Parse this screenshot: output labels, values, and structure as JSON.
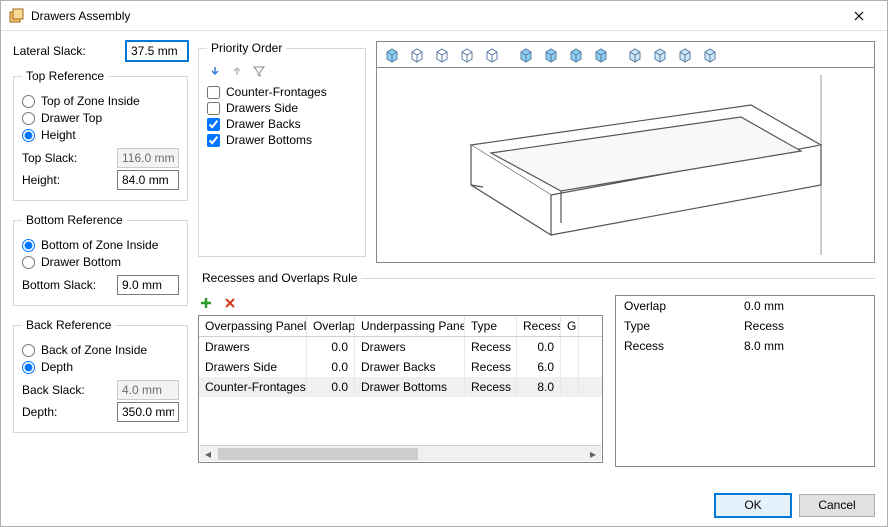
{
  "title": "Drawers Assembly",
  "left": {
    "lateral_slack_label": "Lateral Slack:",
    "lateral_slack_value": "37.5 mm",
    "top_ref": {
      "legend": "Top Reference",
      "opts": [
        "Top of Zone Inside",
        "Drawer Top",
        "Height"
      ],
      "selected": 2,
      "top_slack_label": "Top Slack:",
      "top_slack_value": "116.0 mm",
      "height_label": "Height:",
      "height_value": "84.0 mm"
    },
    "bottom_ref": {
      "legend": "Bottom Reference",
      "opts": [
        "Bottom of Zone Inside",
        "Drawer Bottom"
      ],
      "selected": 0,
      "bottom_slack_label": "Bottom Slack:",
      "bottom_slack_value": "9.0 mm"
    },
    "back_ref": {
      "legend": "Back Reference",
      "opts": [
        "Back of Zone Inside",
        "Depth"
      ],
      "selected": 1,
      "back_slack_label": "Back Slack:",
      "back_slack_value": "4.0 mm",
      "depth_label": "Depth:",
      "depth_value": "350.0 mm"
    }
  },
  "priority": {
    "legend": "Priority Order",
    "items": [
      {
        "label": "Counter-Frontages",
        "checked": false
      },
      {
        "label": "Drawers Side",
        "checked": false
      },
      {
        "label": "Drawer Backs",
        "checked": true
      },
      {
        "label": "Drawer Bottoms",
        "checked": true
      }
    ]
  },
  "recesses": {
    "legend": "Recesses and Overlaps Rule",
    "cols": [
      "Overpassing Panel",
      "Overlap",
      "Underpassing Panel",
      "Type",
      "Recess",
      "G"
    ],
    "rows": [
      {
        "op": "Drawers",
        "ov": "0.0",
        "up": "Drawers",
        "ty": "Recess",
        "re": "0.0",
        "sel": false
      },
      {
        "op": "Drawers Side",
        "ov": "0.0",
        "up": "Drawer Backs",
        "ty": "Recess",
        "re": "6.0",
        "sel": false
      },
      {
        "op": "Counter-Frontages",
        "ov": "0.0",
        "up": "Drawer Bottoms",
        "ty": "Recess",
        "re": "8.0",
        "sel": true
      }
    ],
    "detail": [
      {
        "k": "Overlap",
        "v": "0.0 mm"
      },
      {
        "k": "Type",
        "v": "Recess"
      },
      {
        "k": "Recess",
        "v": "8.0 mm"
      }
    ]
  },
  "buttons": {
    "ok": "OK",
    "cancel": "Cancel"
  }
}
